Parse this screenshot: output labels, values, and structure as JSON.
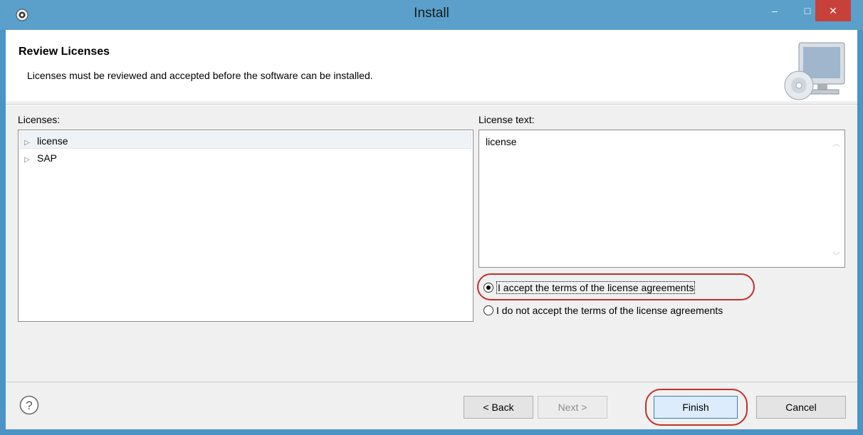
{
  "window": {
    "title": "Install",
    "minimize": "–",
    "maximize": "□",
    "close": "✕"
  },
  "header": {
    "title": "Review Licenses",
    "subtitle": "Licenses must be reviewed and accepted before the software can be installed.",
    "icon": "computer-cd-icon"
  },
  "licenses": {
    "label": "Licenses:",
    "items": [
      {
        "label": "license"
      },
      {
        "label": "SAP"
      }
    ]
  },
  "license_text": {
    "label": "License text:",
    "content": "license"
  },
  "options": {
    "accept": {
      "label": "I accept the terms of the license agreements",
      "selected": true
    },
    "decline": {
      "label": "I do not accept the terms of the license agreements",
      "selected": false
    }
  },
  "buttons": {
    "back": "< Back",
    "next": "Next >",
    "finish": "Finish",
    "cancel": "Cancel"
  },
  "colors": {
    "titlebar": "#5aa0cb",
    "close": "#c7413a",
    "highlight": "#c0312a"
  }
}
